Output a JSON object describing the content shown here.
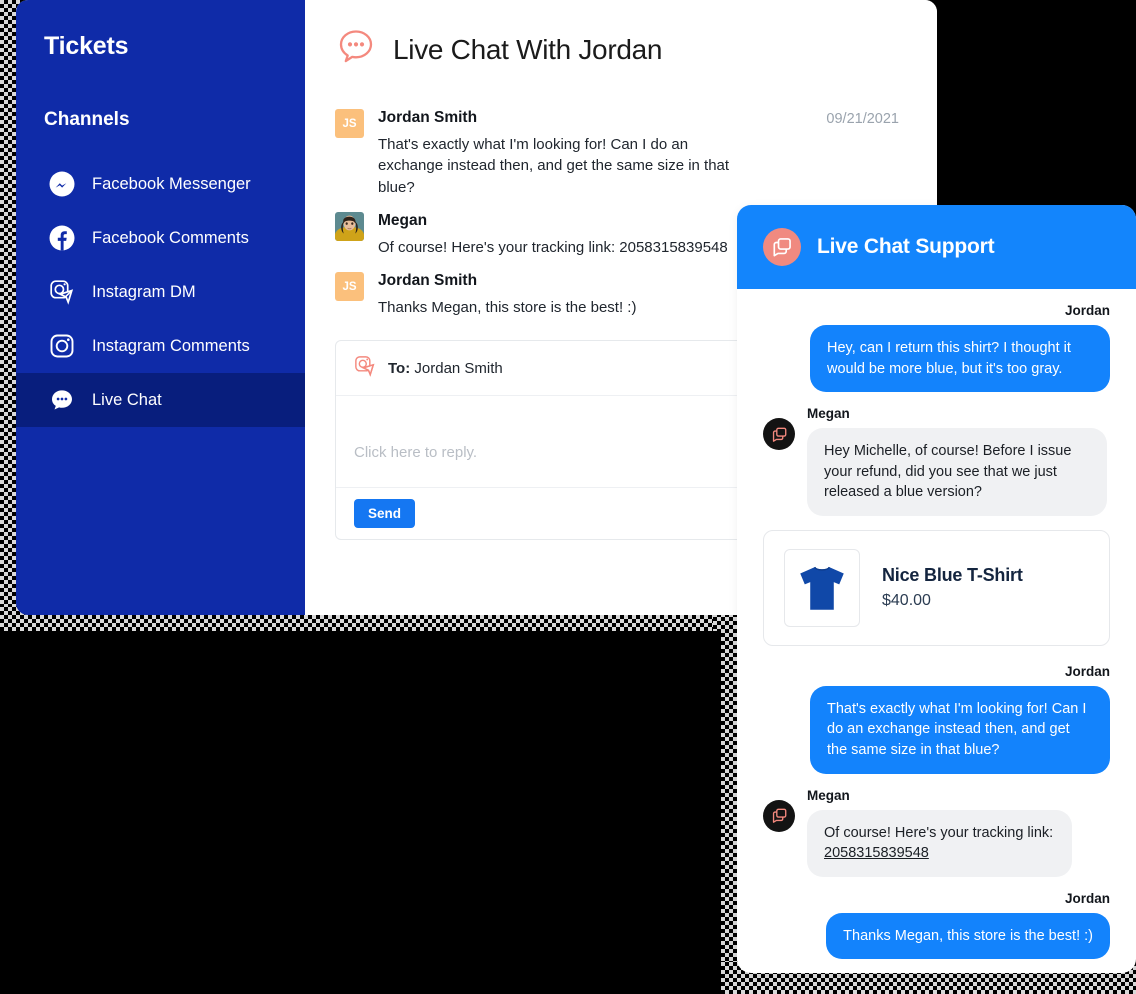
{
  "sidebar": {
    "title": "Tickets",
    "section_label": "Channels",
    "items": [
      {
        "label": "Facebook Messenger",
        "icon": "facebook-messenger-icon",
        "active": false
      },
      {
        "label": "Facebook Comments",
        "icon": "facebook-icon",
        "active": false
      },
      {
        "label": "Instagram DM",
        "icon": "instagram-dm-icon",
        "active": false
      },
      {
        "label": "Instagram Comments",
        "icon": "instagram-icon",
        "active": false
      },
      {
        "label": "Live Chat",
        "icon": "chat-bubble-icon",
        "active": true
      }
    ]
  },
  "conversation": {
    "header_title": "Live Chat With Jordan",
    "header_icon": "chat-bubble-dots-icon",
    "date": "09/21/2021",
    "messages": [
      {
        "author": "Jordan Smith",
        "avatar_type": "initials",
        "avatar_initials": "JS",
        "text": "That's exactly what I'm looking for! Can I do an exchange instead then, and get the same size in that blue?"
      },
      {
        "author": "Megan",
        "avatar_type": "photo",
        "avatar_initials": "",
        "text": "Of course! Here's your tracking link: 2058315839548"
      },
      {
        "author": "Jordan Smith",
        "avatar_type": "initials",
        "avatar_initials": "JS",
        "text": "Thanks Megan, this store is the best! :)"
      }
    ],
    "composer": {
      "to_label": "To:",
      "to_value": "Jordan Smith",
      "to_icon": "instagram-dm-icon",
      "placeholder": "Click here to reply.",
      "send_label": "Send"
    }
  },
  "widget": {
    "title": "Live Chat Support",
    "header_icon": "chat-windows-icon",
    "agent_avatar_icon": "chat-windows-icon",
    "messages": [
      {
        "direction": "out",
        "name": "Jordan",
        "text": "Hey, can I return this shirt? I thought it would be more blue, but it's too gray."
      },
      {
        "direction": "in",
        "name": "Megan",
        "text": "Hey Michelle, of course! Before I issue your refund, did you see that we just released a blue version?"
      },
      {
        "direction": "out",
        "name": "Jordan",
        "text": "That's exactly what I'm looking for! Can I do an exchange instead then, and get the same size in that blue?"
      },
      {
        "direction": "in",
        "name": "Megan",
        "text_prefix": "Of course! Here's your tracking link: ",
        "link_text": "2058315839548",
        "text": ""
      },
      {
        "direction": "out",
        "name": "Jordan",
        "text": "Thanks Megan, this store is the best! :)"
      }
    ],
    "product": {
      "name": "Nice Blue T-Shirt",
      "price": "$40.00",
      "image_icon": "blue-tshirt-icon"
    }
  },
  "colors": {
    "sidebar_bg": "#0f2ba8",
    "sidebar_active_bg": "#081e7d",
    "widget_header_blue": "#1385fc",
    "bubble_blue": "#1383fc",
    "bubble_gray": "#f0f1f3",
    "accent_coral": "#f08a80",
    "avatar_orange": "#fbc07c",
    "send_blue": "#1577f2",
    "tshirt_blue": "#1048a8"
  }
}
